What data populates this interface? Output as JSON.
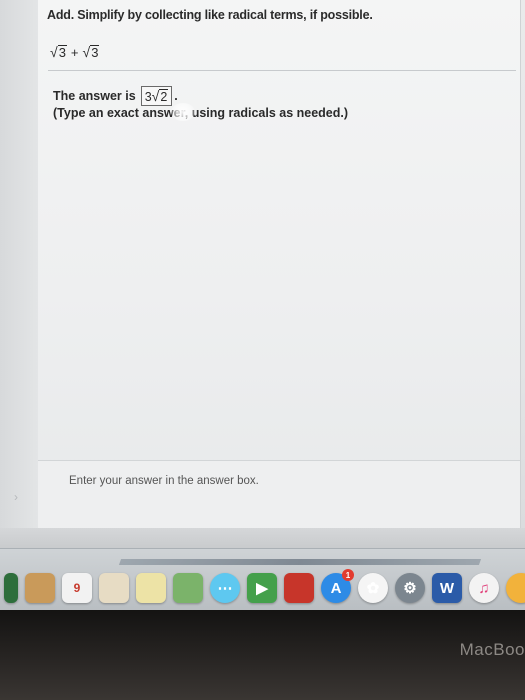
{
  "question": {
    "instruction": "Add. Simplify by collecting like radical terms, if possible.",
    "term1_radicand": "3",
    "operator": "+",
    "term2_radicand": "3"
  },
  "answer": {
    "prefix": "The answer is",
    "coefficient": "3",
    "radicand": "2",
    "suffix": ".",
    "hint": "(Type an exact answer, using radicals as needed.)"
  },
  "status": {
    "message": "Enter your answer in the answer box."
  },
  "dock": {
    "calendar_day": "9",
    "word_letter": "W",
    "appstore_badge": "1"
  },
  "hardware": {
    "brand": "MacBoo"
  }
}
